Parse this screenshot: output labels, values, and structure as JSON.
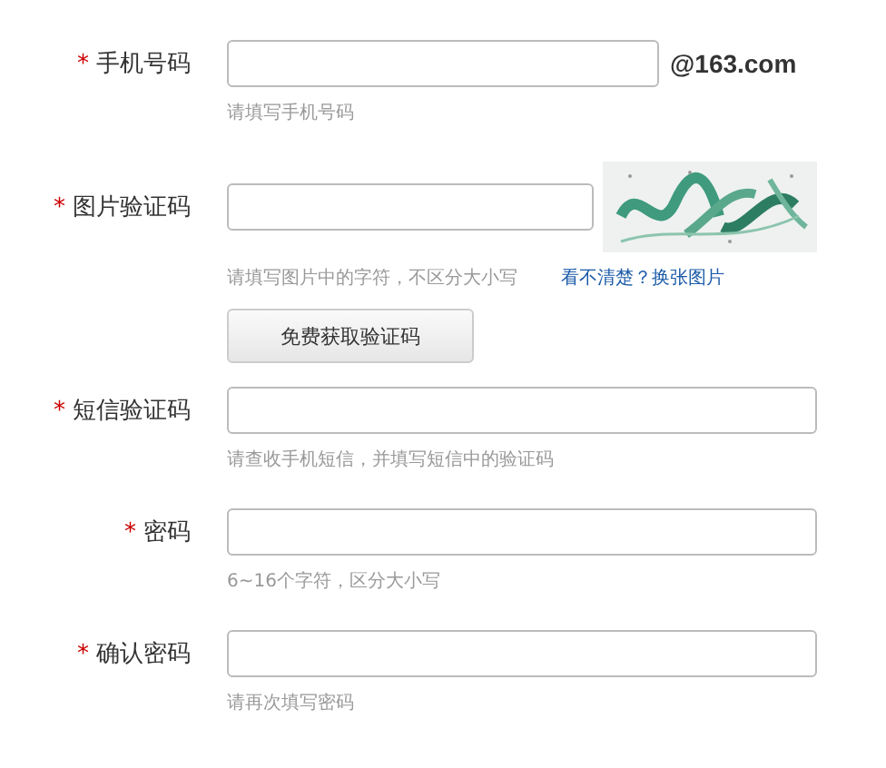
{
  "fields": [
    {
      "kind": "suffix",
      "label": "手机号码",
      "asterisk": "*",
      "suffix": "@163.com",
      "hint": "请填写手机号码"
    },
    {
      "kind": "captcha",
      "label": "图片验证码",
      "asterisk": "*",
      "hint": "请填写图片中的字符，不区分大小写",
      "link": "看不清楚？换张图片"
    },
    {
      "kind": "button",
      "text": "免费获取验证码"
    },
    {
      "kind": "full",
      "label": "短信验证码",
      "asterisk": "*",
      "hint": "请查收手机短信，并填写短信中的验证码"
    },
    {
      "kind": "full",
      "label": "密码",
      "asterisk": "*",
      "hint": "6~16个字符，区分大小写"
    },
    {
      "kind": "full",
      "label": "确认密码",
      "asterisk": "*",
      "hint": "请再次填写密码"
    }
  ]
}
